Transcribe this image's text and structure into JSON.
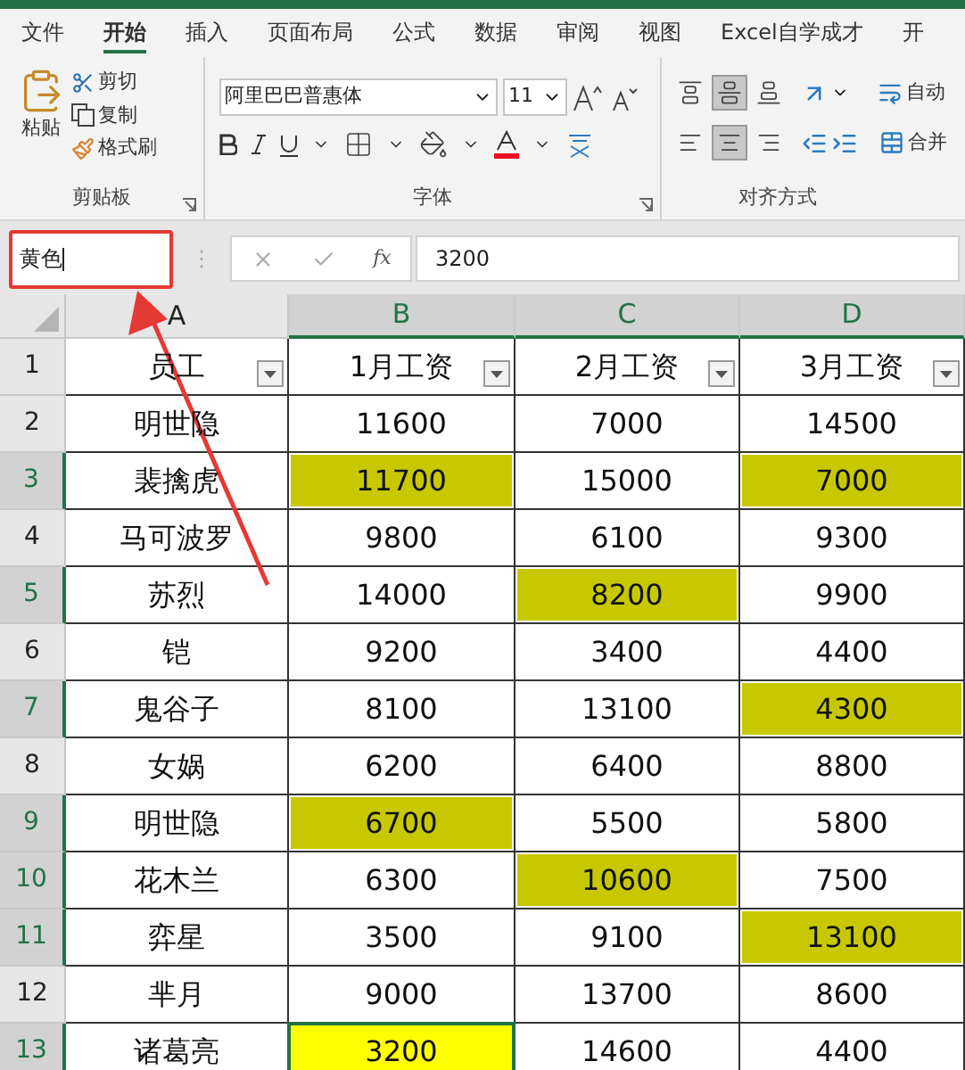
{
  "tabs": [
    {
      "label": "文件",
      "selected": false
    },
    {
      "label": "开始",
      "selected": true
    },
    {
      "label": "插入",
      "selected": false
    },
    {
      "label": "页面布局",
      "selected": false
    },
    {
      "label": "公式",
      "selected": false
    },
    {
      "label": "数据",
      "selected": false
    },
    {
      "label": "审阅",
      "selected": false
    },
    {
      "label": "视图",
      "selected": false
    },
    {
      "label": "Excel自学成才",
      "selected": false
    },
    {
      "label": "开",
      "selected": false
    }
  ],
  "clipboard": {
    "paste": "粘贴",
    "cut": "剪切",
    "copy": "复制",
    "format_painter": "格式刷",
    "label": "剪贴板"
  },
  "font": {
    "font_name": "阿里巴巴普惠体",
    "font_size": "11",
    "label": "字体"
  },
  "alignment": {
    "vertical": [
      {
        "kind": "top",
        "selected": false
      },
      {
        "kind": "middle",
        "selected": true
      },
      {
        "kind": "bottom",
        "selected": false
      }
    ],
    "horizontal": [
      {
        "kind": "left",
        "selected": false
      },
      {
        "kind": "center",
        "selected": true
      },
      {
        "kind": "right",
        "selected": false
      }
    ],
    "wrap": "自动",
    "merge": "合并",
    "label": "对齐方式"
  },
  "formula_bar": {
    "name_box": "黄色",
    "separator": "⋮",
    "fx": "fx",
    "value": "3200"
  },
  "columns": [
    {
      "label": "A",
      "selected": false
    },
    {
      "label": "B",
      "selected": true
    },
    {
      "label": "C",
      "selected": true
    },
    {
      "label": "D",
      "selected": true
    }
  ],
  "rows": [
    {
      "number": "1",
      "selected": false,
      "filter": true,
      "cells": [
        {
          "text": "员工"
        },
        {
          "text": "1月工资"
        },
        {
          "text": "2月工资"
        },
        {
          "text": "3月工资"
        }
      ]
    },
    {
      "number": "2",
      "selected": false,
      "cells": [
        {
          "text": "明世隐"
        },
        {
          "text": "11600"
        },
        {
          "text": "7000"
        },
        {
          "text": "14500"
        }
      ]
    },
    {
      "number": "3",
      "selected": true,
      "cells": [
        {
          "text": "裴擒虎"
        },
        {
          "text": "11700",
          "color": "#c8c800"
        },
        {
          "text": "15000"
        },
        {
          "text": "7000",
          "color": "#c8c800"
        }
      ]
    },
    {
      "number": "4",
      "selected": false,
      "cells": [
        {
          "text": "马可波罗"
        },
        {
          "text": "9800"
        },
        {
          "text": "6100"
        },
        {
          "text": "9300"
        }
      ]
    },
    {
      "number": "5",
      "selected": true,
      "cells": [
        {
          "text": "苏烈"
        },
        {
          "text": "14000"
        },
        {
          "text": "8200",
          "color": "#c8c800"
        },
        {
          "text": "9900"
        }
      ]
    },
    {
      "number": "6",
      "selected": false,
      "cells": [
        {
          "text": "铠"
        },
        {
          "text": "9200"
        },
        {
          "text": "3400"
        },
        {
          "text": "4400"
        }
      ]
    },
    {
      "number": "7",
      "selected": true,
      "cells": [
        {
          "text": "鬼谷子"
        },
        {
          "text": "8100"
        },
        {
          "text": "13100"
        },
        {
          "text": "4300",
          "color": "#c8c800"
        }
      ]
    },
    {
      "number": "8",
      "selected": false,
      "cells": [
        {
          "text": "女娲"
        },
        {
          "text": "6200"
        },
        {
          "text": "6400"
        },
        {
          "text": "8800"
        }
      ]
    },
    {
      "number": "9",
      "selected": true,
      "cells": [
        {
          "text": "明世隐"
        },
        {
          "text": "6700",
          "color": "#c8c800"
        },
        {
          "text": "5500"
        },
        {
          "text": "5800"
        }
      ]
    },
    {
      "number": "10",
      "selected": true,
      "cells": [
        {
          "text": "花木兰"
        },
        {
          "text": "6300"
        },
        {
          "text": "10600",
          "color": "#c8c800"
        },
        {
          "text": "7500"
        }
      ]
    },
    {
      "number": "11",
      "selected": true,
      "cells": [
        {
          "text": "弈星"
        },
        {
          "text": "3500"
        },
        {
          "text": "9100"
        },
        {
          "text": "13100",
          "color": "#c8c800"
        }
      ]
    },
    {
      "number": "12",
      "selected": false,
      "cells": [
        {
          "text": "芈月"
        },
        {
          "text": "9000"
        },
        {
          "text": "13700"
        },
        {
          "text": "8600"
        }
      ]
    },
    {
      "number": "13",
      "selected": true,
      "cells": [
        {
          "text": "诸葛亮"
        },
        {
          "text": "3200",
          "color": "#ffff00",
          "active": true
        },
        {
          "text": "14600"
        },
        {
          "text": "4400"
        }
      ]
    }
  ]
}
